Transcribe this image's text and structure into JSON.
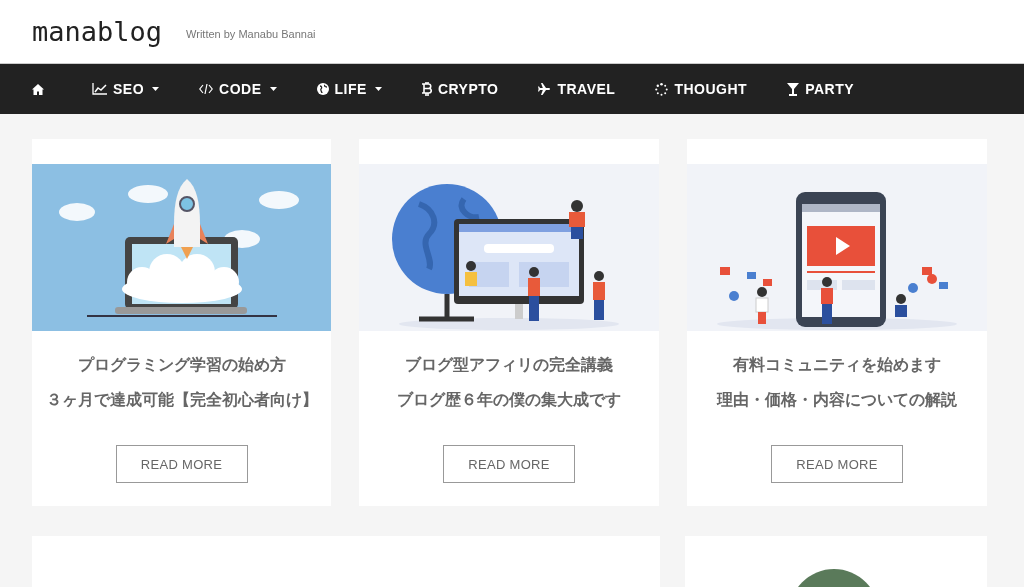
{
  "header": {
    "site_title": "manablog",
    "tagline": "Written by Manabu Bannai"
  },
  "nav": [
    {
      "kind": "home",
      "dropdown": false
    },
    {
      "kind": "chart",
      "label": "SEO",
      "dropdown": true
    },
    {
      "kind": "code",
      "label": "CODE",
      "dropdown": true
    },
    {
      "kind": "globe",
      "label": "LIFE",
      "dropdown": true
    },
    {
      "kind": "bitcoin",
      "label": "CRYPTO",
      "dropdown": false
    },
    {
      "kind": "plane",
      "label": "TRAVEL",
      "dropdown": false
    },
    {
      "kind": "spinner",
      "label": "THOUGHT",
      "dropdown": false
    },
    {
      "kind": "glass",
      "label": "PARTY",
      "dropdown": false
    }
  ],
  "cards": [
    {
      "kind": "rocket",
      "title_lines": [
        "プログラミング学習の始め方",
        "３ヶ月で達成可能【完全初心者向け】"
      ],
      "button": "READ MORE"
    },
    {
      "kind": "globe",
      "title_lines": [
        "ブログ型アフィリの完全講義",
        "ブログ歴６年の僕の集大成です"
      ],
      "button": "READ MORE"
    },
    {
      "kind": "phone",
      "title_lines": [
        "有料コミュニティを始めます",
        "理由・価格・内容についての解説"
      ],
      "button": "READ MORE"
    }
  ],
  "lower_cards": [
    {
      "kind": "wide"
    },
    {
      "kind": "avatar"
    }
  ]
}
